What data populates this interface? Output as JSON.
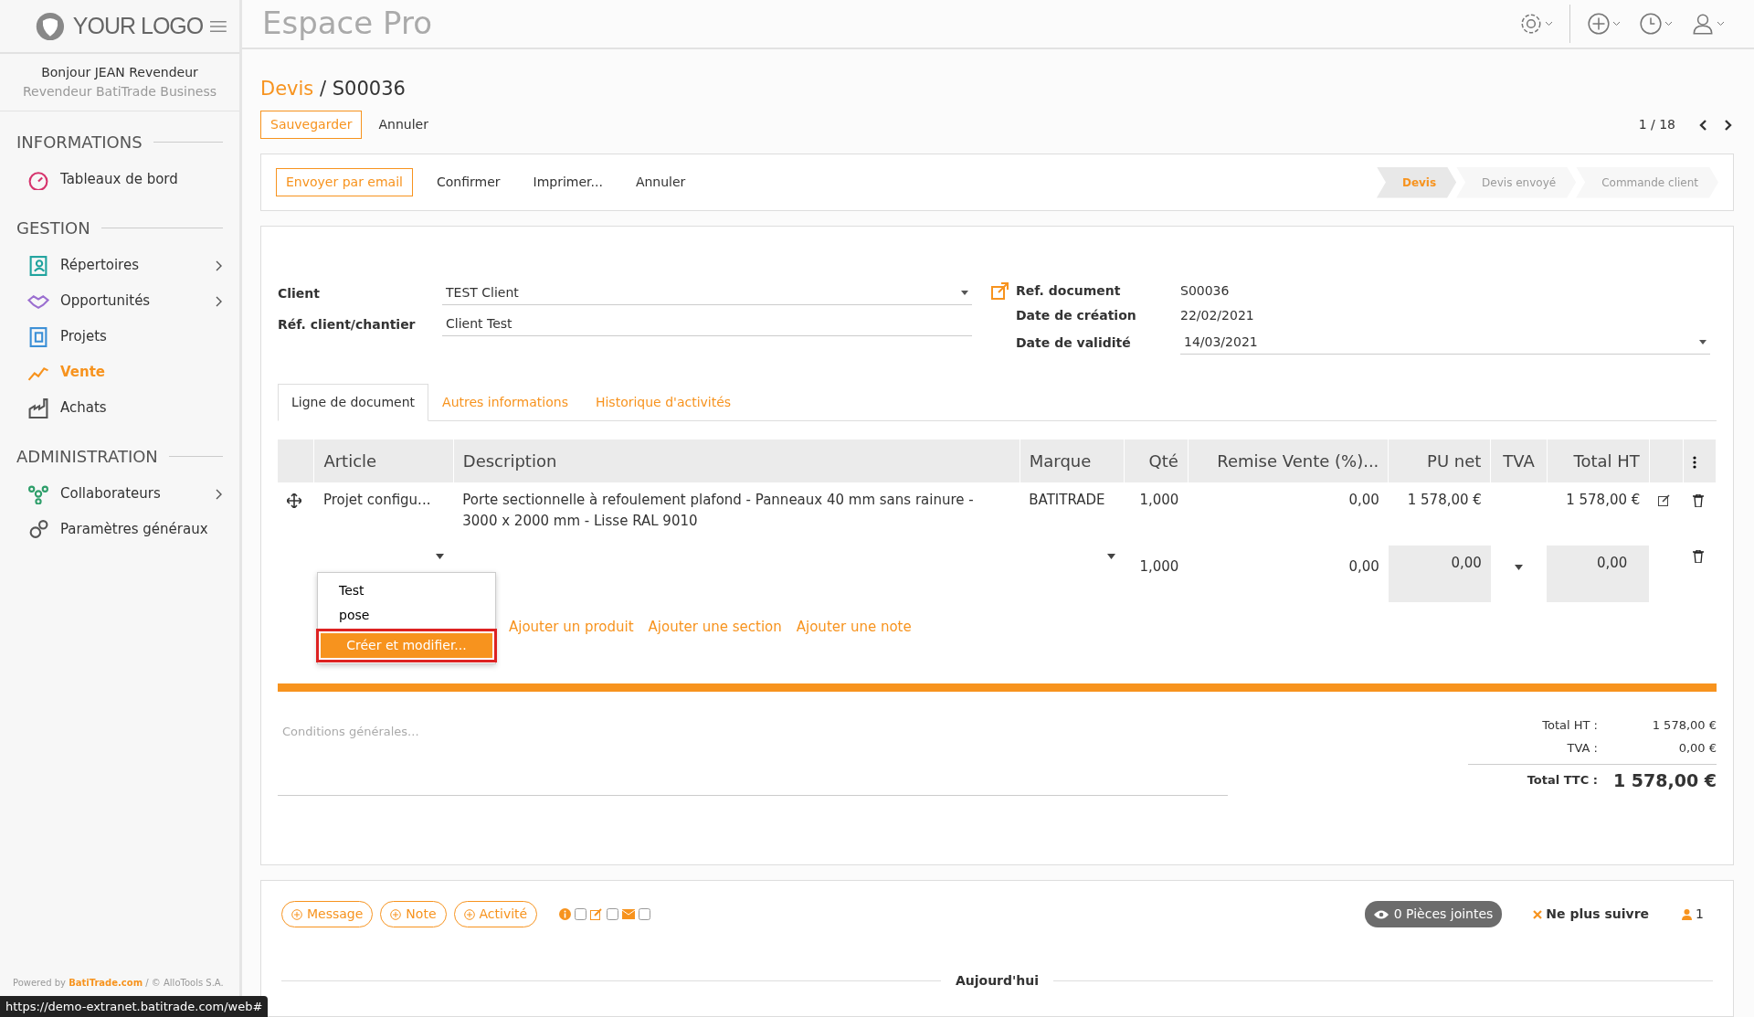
{
  "logo": {
    "text": "YOUR LOGO"
  },
  "app_title": "Espace Pro",
  "user": {
    "greeting": "Bonjour JEAN Revendeur",
    "role": "Revendeur BatiTrade Business"
  },
  "sidebar": {
    "sections": [
      {
        "title": "INFORMATIONS",
        "items": [
          {
            "label": "Tableaux de bord",
            "color": "#d6336c",
            "selected": false,
            "expandable": false
          }
        ]
      },
      {
        "title": "GESTION",
        "items": [
          {
            "label": "Répertoires",
            "color": "#20a39e",
            "selected": false,
            "expandable": true
          },
          {
            "label": "Opportunités",
            "color": "#9b6fd0",
            "selected": false,
            "expandable": true
          },
          {
            "label": "Projets",
            "color": "#3b8fd6",
            "selected": false,
            "expandable": false
          },
          {
            "label": "Vente",
            "color": "#f7931e",
            "selected": true,
            "expandable": false
          },
          {
            "label": "Achats",
            "color": "#555555",
            "selected": false,
            "expandable": false
          }
        ]
      },
      {
        "title": "ADMINISTRATION",
        "items": [
          {
            "label": "Collaborateurs",
            "color": "#2e9e6a",
            "selected": false,
            "expandable": true
          },
          {
            "label": "Paramètres généraux",
            "color": "#555555",
            "selected": false,
            "expandable": false
          }
        ]
      }
    ]
  },
  "footer": {
    "prefix": "Powered by",
    "link": "BatiTrade.com",
    "suffix": "/ © AlloTools S.A."
  },
  "status_url": "https://demo-extranet.batitrade.com/web#",
  "breadcrumb": {
    "parent": "Devis",
    "separator": "/",
    "current": "S00036"
  },
  "actions": [
    {
      "label": "Sauvegarder",
      "kind": "primary"
    },
    {
      "label": "Annuler",
      "kind": "link"
    }
  ],
  "pager": {
    "text": "1 / 18"
  },
  "status_actions": [
    {
      "label": "Envoyer par email",
      "kind": "primary"
    },
    {
      "label": "Confirmer",
      "kind": "link"
    },
    {
      "label": "Imprimer...",
      "kind": "link"
    },
    {
      "label": "Annuler",
      "kind": "link"
    }
  ],
  "stages": [
    {
      "label": "Devis",
      "selected": true
    },
    {
      "label": "Devis envoyé",
      "selected": false
    },
    {
      "label": "Commande client",
      "selected": false
    }
  ],
  "form": {
    "left": [
      {
        "label": "Client",
        "value": "TEST Client",
        "kind": "select"
      },
      {
        "label": "Réf. client/chantier",
        "value": "Client Test",
        "kind": "input"
      }
    ],
    "right": [
      {
        "label": "Ref. document",
        "value": "S00036",
        "kind": "text"
      },
      {
        "label": "Date de création",
        "value": "22/02/2021",
        "kind": "text"
      },
      {
        "label": "Date de validité",
        "value": "14/03/2021",
        "kind": "select"
      }
    ]
  },
  "tabs": [
    {
      "label": "Ligne de document",
      "selected": true
    },
    {
      "label": "Autres informations",
      "selected": false
    },
    {
      "label": "Historique d'activités",
      "selected": false
    }
  ],
  "table": {
    "columns": [
      "Article",
      "Description",
      "Marque",
      "Qté",
      "Remise Vente (%)...",
      "PU net",
      "TVA",
      "Total HT"
    ],
    "rows": [
      {
        "kind": "line",
        "article": "Projet configu...",
        "description": "Porte sectionnelle à refoulement plafond - Panneaux 40 mm sans rainure - 3000 x 2000 mm - Lisse RAL 9010",
        "brand": "BATITRADE",
        "qty": "1,000",
        "discount": "0,00",
        "unit_price": "1 578,00 €",
        "total": "1 578,00 €"
      },
      {
        "kind": "edit",
        "qty": "1,000",
        "discount": "0,00",
        "unit_price": "0,00",
        "total": "0,00"
      }
    ]
  },
  "dropdown": {
    "options": [
      {
        "label": "Test",
        "selected": false,
        "highlighted": false
      },
      {
        "label": "pose",
        "selected": false,
        "highlighted": false
      },
      {
        "label": "Créer et modifier...",
        "selected": true,
        "highlighted": true
      }
    ]
  },
  "add_links": [
    "Ajouter un produit",
    "Ajouter une section",
    "Ajouter une note"
  ],
  "conditions": {
    "placeholder": "Conditions générales..."
  },
  "totals": [
    {
      "label": "Total HT :",
      "value": "1 578,00 €",
      "kind": "sub"
    },
    {
      "label": "TVA :",
      "value": "0,00 €",
      "kind": "sub"
    },
    {
      "label": "Total TTC :",
      "value": "1 578,00 €",
      "kind": "grand"
    }
  ],
  "chatter": {
    "buttons": [
      "Message",
      "Note",
      "Activité"
    ],
    "attachments": "0 Pièces jointes",
    "unfollow": "Ne plus suivre",
    "followers": "1",
    "divider": "Aujourd'hui"
  }
}
